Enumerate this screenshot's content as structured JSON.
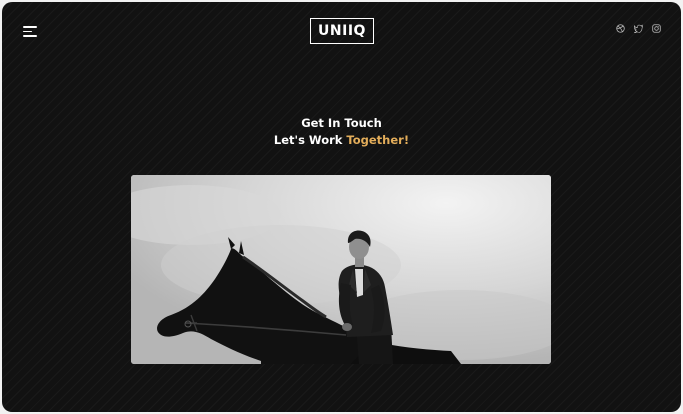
{
  "header": {
    "logo_text": "UNIIQ",
    "menu_icon": "hamburger-menu-icon",
    "socials": [
      {
        "name": "dribbble-icon"
      },
      {
        "name": "twitter-icon"
      },
      {
        "name": "instagram-icon"
      }
    ]
  },
  "main": {
    "heading_line1": "Get In Touch",
    "heading_line2_prefix": "Let's Work ",
    "heading_line2_accent": "Together!",
    "hero_image": "man-riding-horse-photo"
  },
  "colors": {
    "background": "#121212",
    "accent": "#e3ad5a",
    "text": "#ffffff"
  }
}
